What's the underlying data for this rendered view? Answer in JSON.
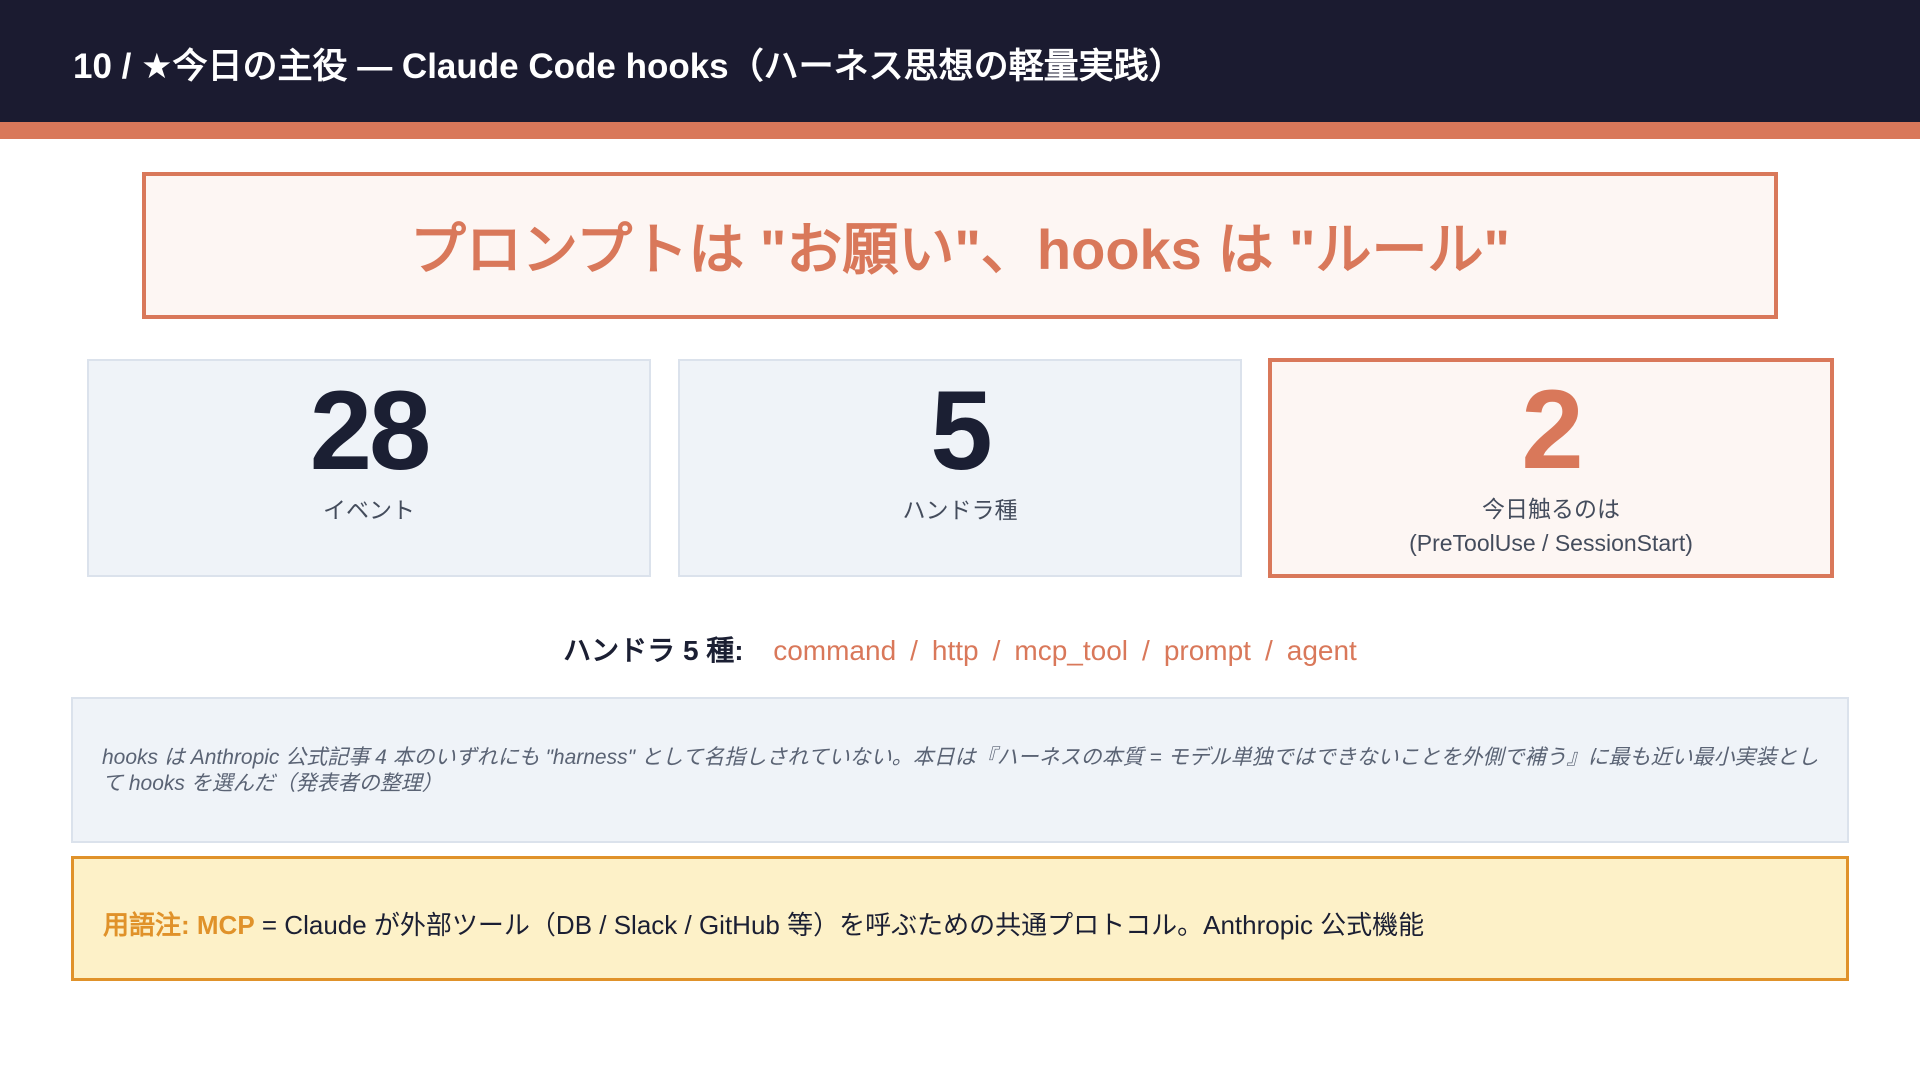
{
  "header": {
    "title": "10 / ★今日の主役 — Claude Code hooks（ハーネス思想の軽量実践）"
  },
  "motto": "プロンプトは \"お願い\"、hooks は \"ルール\"",
  "stats": [
    {
      "value": "28",
      "label": "イベント",
      "sublabel": ""
    },
    {
      "value": "5",
      "label": "ハンドラ種",
      "sublabel": ""
    },
    {
      "value": "2",
      "label": "今日触るのは",
      "sublabel": "(PreToolUse / SessionStart)"
    }
  ],
  "handlers": {
    "label": "ハンドラ 5 種:",
    "items": [
      "command",
      "http",
      "mcp_tool",
      "prompt",
      "agent"
    ],
    "separator": "/"
  },
  "note": {
    "text": "hooks は Anthropic 公式記事 4 本のいずれにも \"harness\" として名指しされていない。本日は『ハーネスの本質 = モデル単独ではできないことを外側で補う』に最も近い最小実装として hooks を選んだ（発表者の整理）"
  },
  "glossary": {
    "key": "用語注: MCP",
    "text": " = Claude が外部ツール（DB / Slack / GitHub 等）を呼ぶための共通プロトコル。Anthropic 公式機能"
  },
  "colors": {
    "header_bg": "#1b1b30",
    "accent": "#d9785a",
    "panel_bg": "#eff3f8",
    "glossary_bg": "#fdf1c8",
    "glossary_border": "#e0922a"
  }
}
